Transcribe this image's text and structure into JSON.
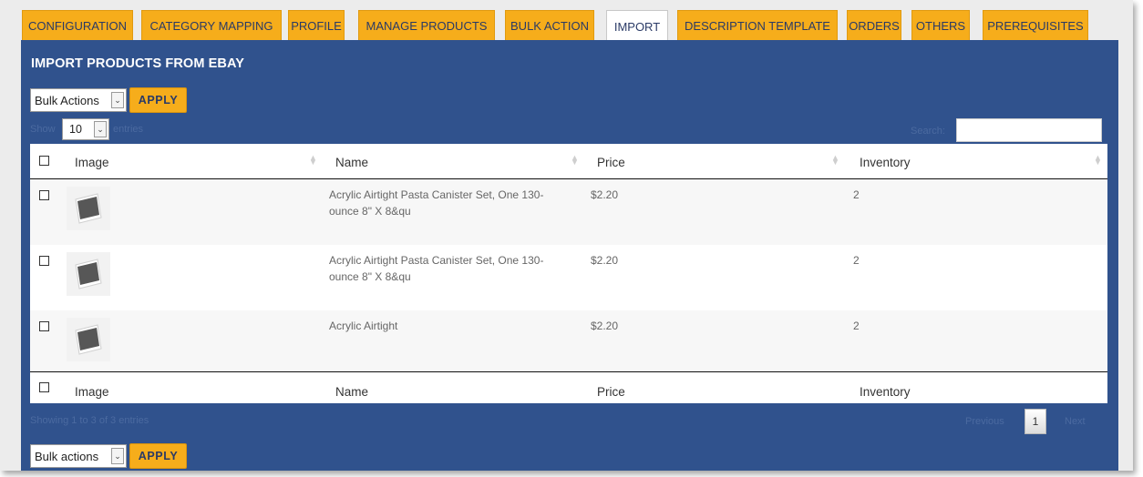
{
  "tabs": [
    {
      "label": "CONFIGURATION",
      "active": false
    },
    {
      "label": "CATEGORY MAPPING",
      "active": false
    },
    {
      "label": "PROFILE",
      "active": false
    },
    {
      "label": "MANAGE PRODUCTS",
      "active": false
    },
    {
      "label": "BULK ACTION",
      "active": false
    },
    {
      "label": "IMPORT",
      "active": true
    },
    {
      "label": "DESCRIPTION TEMPLATE",
      "active": false
    },
    {
      "label": "ORDERS",
      "active": false
    },
    {
      "label": "OTHERS",
      "active": false
    },
    {
      "label": "PREREQUISITES",
      "active": false
    }
  ],
  "panel": {
    "title": "IMPORT PRODUCTS FROM EBAY"
  },
  "top_controls": {
    "bulk_select": "Bulk Actions",
    "apply": "APPLY"
  },
  "length": {
    "show": "Show",
    "value": "10",
    "entries": "entries"
  },
  "search": {
    "label": "Search:",
    "value": ""
  },
  "columns": [
    "Image",
    "Name",
    "Price",
    "Inventory"
  ],
  "rows": [
    {
      "name": "Acrylic Airtight Pasta Canister Set, One 130-ounce 8\" X 8&qu",
      "price": "$2.20",
      "inventory": "2"
    },
    {
      "name": "Acrylic Airtight Pasta Canister Set, One 130-ounce 8\" X 8&qu",
      "price": "$2.20",
      "inventory": "2"
    },
    {
      "name": "Acrylic Airtight",
      "price": "$2.20",
      "inventory": "2"
    }
  ],
  "info": "Showing 1 to 3 of 3 entries",
  "pagination": {
    "previous": "Previous",
    "page": "1",
    "next": "Next"
  },
  "bottom_controls": {
    "bulk_select": "Bulk actions",
    "apply": "APPLY"
  },
  "colors": {
    "accent": "#f6ad1b",
    "panel": "#30528d",
    "tab_text": "#2a3a66"
  }
}
